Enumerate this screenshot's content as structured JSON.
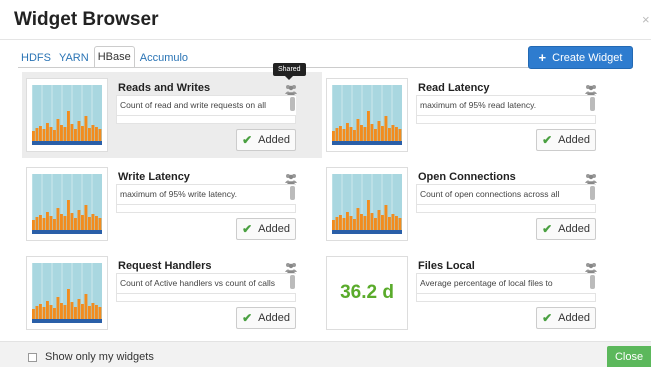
{
  "dialog": {
    "title": "Widget Browser",
    "close_glyph": "×"
  },
  "tabs": [
    {
      "label": "HDFS",
      "active": false
    },
    {
      "label": "YARN",
      "active": false
    },
    {
      "label": "HBase",
      "active": true
    },
    {
      "label": "Accumulo",
      "active": false
    }
  ],
  "create_button": {
    "icon": "plus-icon",
    "label": "Create Widget"
  },
  "tooltip": "Shared",
  "widgets": [
    {
      "name": "Reads and Writes",
      "description": "Count of read and write requests on all",
      "button": "Added",
      "thumbnail": "graph",
      "highlighted": true
    },
    {
      "name": "Read Latency",
      "description": "maximum of 95% read latency.",
      "button": "Added",
      "thumbnail": "graph",
      "highlighted": false
    },
    {
      "name": "Write Latency",
      "description": "maximum of 95% write latency.",
      "button": "Added",
      "thumbnail": "graph",
      "highlighted": false
    },
    {
      "name": "Open Connections",
      "description": "Count of open connections across all",
      "button": "Added",
      "thumbnail": "graph",
      "highlighted": false
    },
    {
      "name": "Request Handlers",
      "description": "Count of Active handlers vs count of calls",
      "button": "Added",
      "thumbnail": "graph",
      "highlighted": false
    },
    {
      "name": "Files Local",
      "description": "Average percentage of local files to",
      "button": "Added",
      "thumbnail": "number",
      "value": "36.2 d",
      "highlighted": false
    }
  ],
  "footer": {
    "checkbox_label": "Show only my widgets",
    "checkbox_checked": false,
    "close_label": "Close"
  },
  "colors": {
    "primary": "#2e7ccf",
    "success": "#5cb85c",
    "graph_orange": "#f28c1e",
    "graph_blue": "#2a5fa8",
    "graph_area": "#a9d7e0",
    "number_green": "#5aab2b"
  }
}
